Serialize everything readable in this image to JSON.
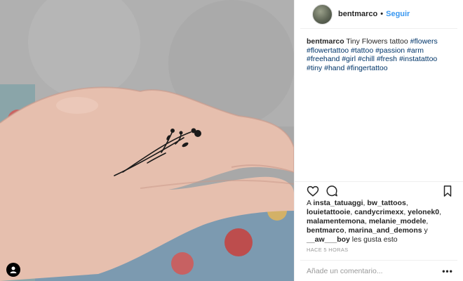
{
  "header": {
    "username": "bentmarco",
    "separator": "•",
    "follow_label": "Seguir"
  },
  "caption": {
    "username": "bentmarco",
    "text": "Tiny Flowers tattoo",
    "hashtags": [
      "#flowers",
      "#flowertattoo",
      "#tattoo",
      "#passion",
      "#arm",
      "#freehand",
      "#girl",
      "#chill",
      "#fresh",
      "#instatattoo",
      "#tiny",
      "#hand",
      "#fingertattoo"
    ]
  },
  "actions": {
    "like_icon": "heart-icon",
    "comment_icon": "comment-icon",
    "save_icon": "bookmark-icon"
  },
  "likes": {
    "prefix": "A",
    "users": [
      "insta_tatuaggi",
      "bw_tattoos",
      "louietattooie",
      "candycrimexx",
      "yelonek0",
      "malamentemona",
      "melanie_modele",
      "bentmarco",
      "marina_and_demons"
    ],
    "conjunction": "y",
    "last_user": "__aw___boy",
    "suffix": "les gusta esto"
  },
  "timestamp": "HACE 5 HORAS",
  "comment": {
    "placeholder": "Añade un comentario...",
    "more_label": "•••"
  },
  "colors": {
    "link": "#3897f0",
    "hashtag": "#003569",
    "text": "#262626",
    "muted": "#999999"
  },
  "photo": {
    "tag_icon": "user-tag-icon"
  }
}
